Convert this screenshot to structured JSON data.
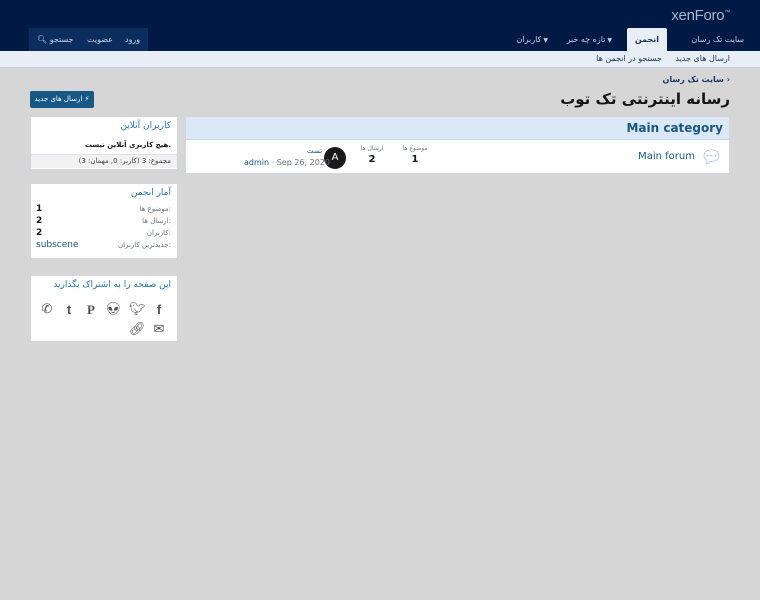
{
  "header": {
    "logo": "xenForo",
    "tabs": [
      "سایت تک رسان",
      "انجمن",
      "تازه چه خبر",
      "کاربران"
    ],
    "login": "ورود",
    "register": "عضویت",
    "search": "جستجو"
  },
  "subnav": {
    "new_posts": "ارسال های جدید",
    "search_forums": "جستجو در انجمن ها"
  },
  "breadcrumb": "سایت تک رسان",
  "page_title": "رسانه اینترنتی تک توب",
  "new_posts_button": "ارسال های جدید",
  "category": {
    "title": "Main category",
    "forum": {
      "title": "Main forum",
      "threads_label": "موضوع ها",
      "threads": "1",
      "messages_label": "ارسال ها",
      "messages": "2",
      "avatar_letter": "A",
      "latest_title": "تست",
      "latest_date": "Sep 26, 2020",
      "latest_user": "admin"
    }
  },
  "online": {
    "title": "کاربران آنلاین",
    "body": "هیچ کاربری آنلاین نیست.",
    "total": "مجموع: 3 (کاربر: 0, مهمان: 3)"
  },
  "stats": {
    "title": "آمار انجمن",
    "rows": [
      {
        "label": "موضوع ها:",
        "value": "1"
      },
      {
        "label": "ارسال ها:",
        "value": "2"
      },
      {
        "label": "کاربران:",
        "value": "2"
      },
      {
        "label": "جدیدترین کاربران:",
        "value": "subscene"
      }
    ]
  },
  "share": {
    "title": "این صفحه را به اشتراک بگذارید"
  },
  "colors": {
    "header": "#001a46",
    "accent": "#185886",
    "link": "#2577b1"
  }
}
